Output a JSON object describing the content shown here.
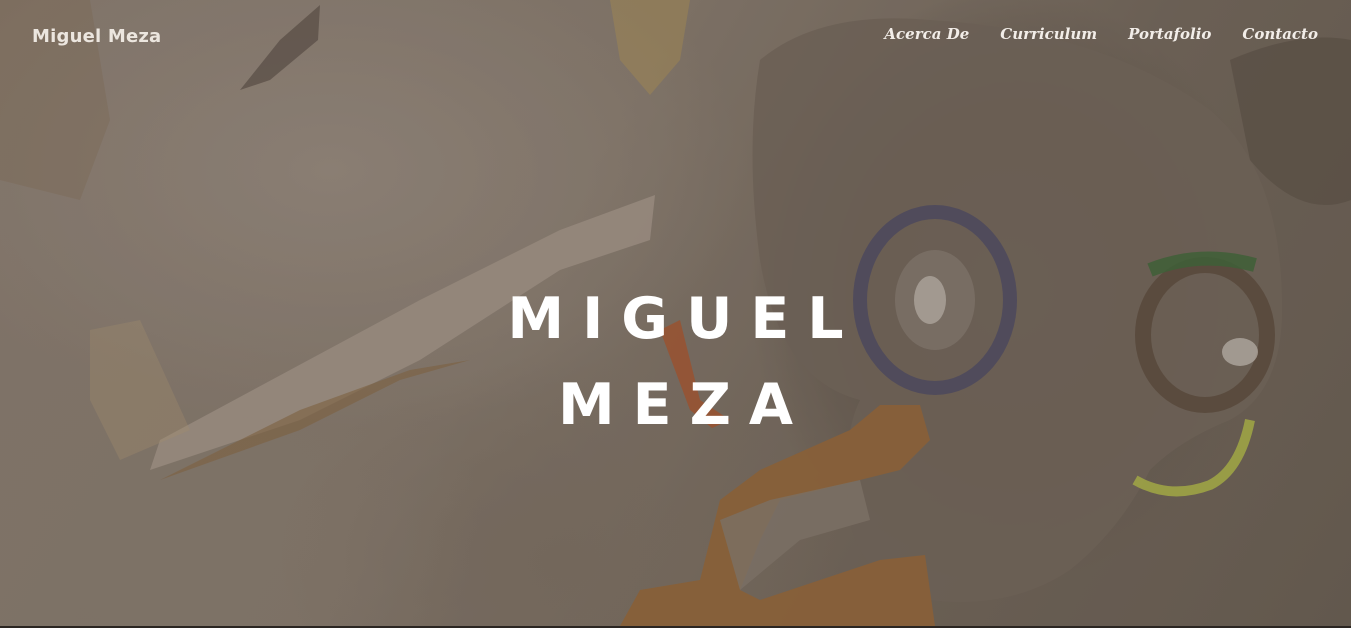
{
  "header": {
    "brand": "Miguel Meza",
    "nav": [
      {
        "label": "Acerca De"
      },
      {
        "label": "Curriculum"
      },
      {
        "label": "Portafolio"
      },
      {
        "label": "Contacto"
      }
    ]
  },
  "hero": {
    "title_line1": "MIGUEL",
    "title_line2": "MEZA"
  }
}
